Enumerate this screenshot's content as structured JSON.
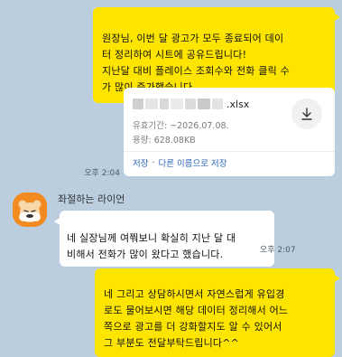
{
  "messages": {
    "m1": {
      "text": "원장님, 이번 달 광고가 모두 종료되어 데이\n터 정리하여 시트에 공유드립니다!\n지난달 대비 플레이스 조회수와 전화 클릭 수\n가 많이 증가했습니다."
    },
    "file": {
      "extension": ".xlsx",
      "expiry": "유효기간: ~2026.07.08.",
      "size": "용량: 628.08KB",
      "save_label": "저장",
      "separator": "·",
      "save_as_label": "다른 이름으로 저장",
      "download_icon": "download-icon"
    },
    "m1_time": "오후 2:04",
    "sender": {
      "name": "좌절하는 라이언",
      "avatar_icon": "ryan-avatar-icon"
    },
    "m2": {
      "text": "네 실장님께 여쭤보니 확실히 지난 달 대\n비해서 전화가 많이 왔다고 했습니다."
    },
    "m2_time": "오후 2:07",
    "m3": {
      "text": "네 그리고 상담하시면서 자연스럽게 유입경\n로도 물어보시면 해당 데이터 정리해서 어느\n쪽으로 광고를 더 강화할지도 알 수 있어서\n그 부분도 전달부탁드립니다^^"
    }
  },
  "colors": {
    "background": "#bacee0",
    "my_bubble": "#fee500",
    "their_bubble": "#ffffff",
    "link": "#2c66b8",
    "avatar": "#f28a22"
  }
}
